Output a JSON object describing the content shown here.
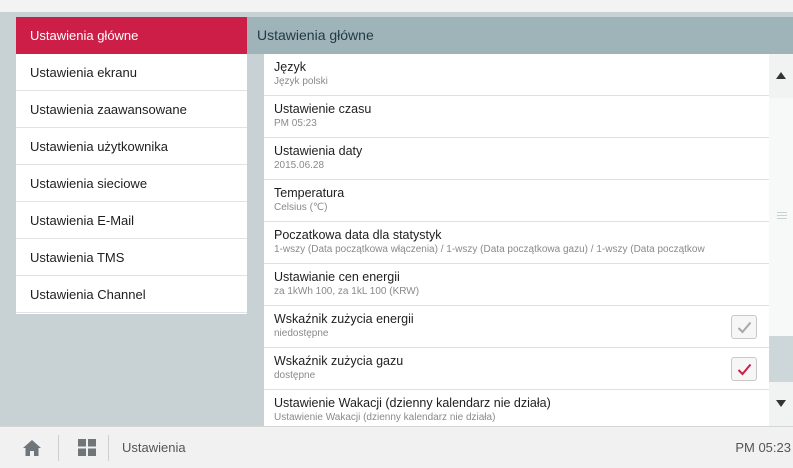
{
  "sidebar": {
    "items": [
      {
        "label": "Ustawienia główne",
        "active": true
      },
      {
        "label": "Ustawienia ekranu"
      },
      {
        "label": "Ustawienia zaawansowane"
      },
      {
        "label": "Ustawienia użytkownika"
      },
      {
        "label": "Ustawienia sieciowe"
      },
      {
        "label": "Ustawienia E-Mail"
      },
      {
        "label": "Ustawienia TMS"
      },
      {
        "label": "Ustawienia Channel"
      }
    ]
  },
  "header": {
    "title": "Ustawienia główne"
  },
  "settings": [
    {
      "title": "Język",
      "value": "Język polski"
    },
    {
      "title": "Ustawienie czasu",
      "value": "PM 05:23"
    },
    {
      "title": "Ustawienia daty",
      "value": "2015.06.28"
    },
    {
      "title": "Temperatura",
      "value": "Celsius (℃)"
    },
    {
      "title": "Poczatkowa data dla statystyk",
      "value": "1-wszy (Data początkowa włączenia) / 1-wszy (Data początkowa gazu) / 1-wszy (Data początkow"
    },
    {
      "title": "Ustawianie cen energii",
      "value": "za 1kWh 100, za 1kL 100 (KRW)"
    },
    {
      "title": "Wskaźnik zużycia energii",
      "value": "niedostępne",
      "checked": false
    },
    {
      "title": "Wskaźnik zużycia gazu",
      "value": "dostępne",
      "checked": true
    },
    {
      "title": "Ustawienie Wakacji (dzienny kalendarz nie działa)",
      "value": "Ustawienie Wakacji (dzienny kalendarz nie działa)"
    }
  ],
  "colors": {
    "accent": "#cc1e46",
    "checked": "#cc1e46",
    "unchecked": "#a8a8a8"
  },
  "bottom_bar": {
    "breadcrumb": "Ustawienia",
    "time": "PM 05:23"
  }
}
